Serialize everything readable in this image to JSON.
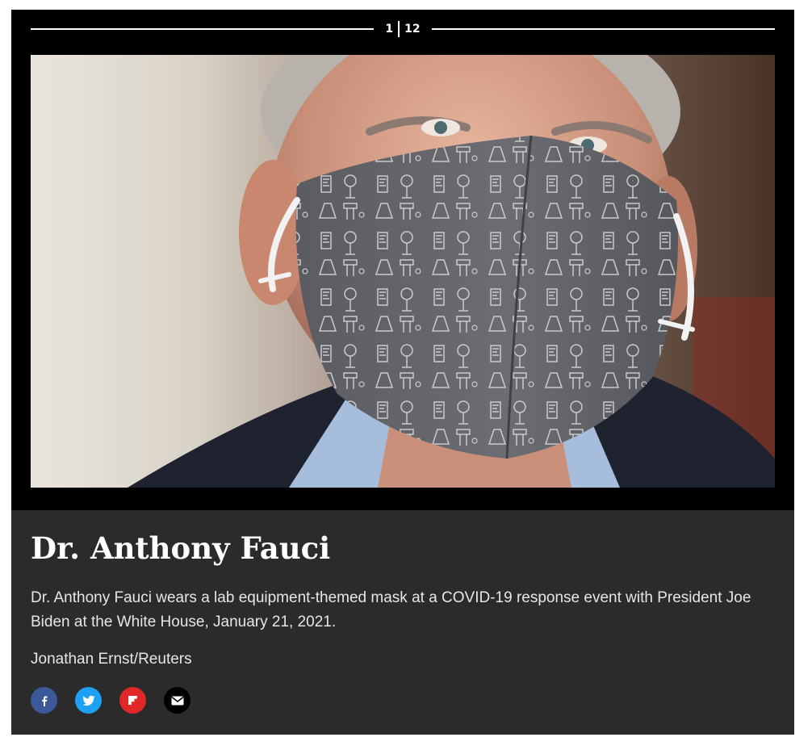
{
  "gallery": {
    "current": "1",
    "total": "12"
  },
  "slide": {
    "title": "Dr. Anthony Fauci",
    "description": "Dr. Anthony Fauci wears a lab equipment-themed mask at a COVID-19 response event with President Joe Biden at the White House, January 21, 2021.",
    "credit": "Jonathan Ernst/Reuters"
  },
  "share": [
    {
      "icon": "facebook-icon",
      "color": "#3b5998"
    },
    {
      "icon": "twitter-icon",
      "color": "#1da1f2"
    },
    {
      "icon": "flipboard-icon",
      "color": "#e12828"
    },
    {
      "icon": "email-icon",
      "color": "#000000"
    }
  ],
  "colors": {
    "slide_background": "#000000",
    "caption_background": "#2b2b2b",
    "text": "#ffffff"
  }
}
